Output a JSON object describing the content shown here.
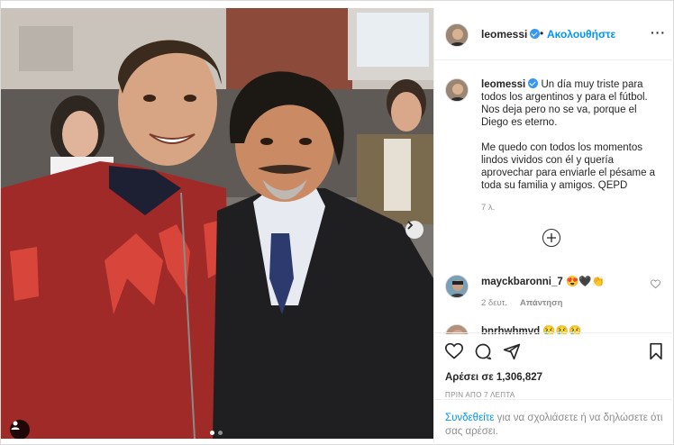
{
  "header": {
    "username": "leomessi",
    "separator": "•",
    "follow_label": "Ακολουθήστε",
    "more_label": "···"
  },
  "caption": {
    "username": "leomessi",
    "text": "Un día muy triste para todos los argentinos y para el fútbol. Nos deja pero no se va, porque el Diego es eterno.\n\nMe quedo con todos los momentos lindos vividos con él y quería aprovechar para enviarle el pésame a toda su familia y amigos. QEPD",
    "time": "7 λ."
  },
  "comments": [
    {
      "username": "mayckbaronni_7",
      "text": "😍🖤👏",
      "time": "2 δευτ.",
      "reply_label": "Απάντηση"
    },
    {
      "username": "bnrhwhmvd",
      "text": "😢😢😢"
    }
  ],
  "actions": {
    "likes": "Αρέσει σε 1,306,827",
    "posted": "ΠΡΙΝ ΑΠΟ 7 ΛΕΠΤΑ"
  },
  "login": {
    "link": "Συνδεθείτε",
    "rest": " για να σχολιάσετε ή να δηλώσετε ότι σας αρέσει."
  },
  "colors": {
    "accent": "#0095f6",
    "verified": "#3897f0",
    "muted": "#8e8e8e",
    "text": "#262626"
  },
  "carousel": {
    "current": 1,
    "total": 2
  },
  "icons": [
    "next-arrow-icon",
    "user-tag-icon",
    "heart-icon",
    "comment-icon",
    "share-icon",
    "save-icon",
    "add-circle-icon",
    "more-icon"
  ]
}
